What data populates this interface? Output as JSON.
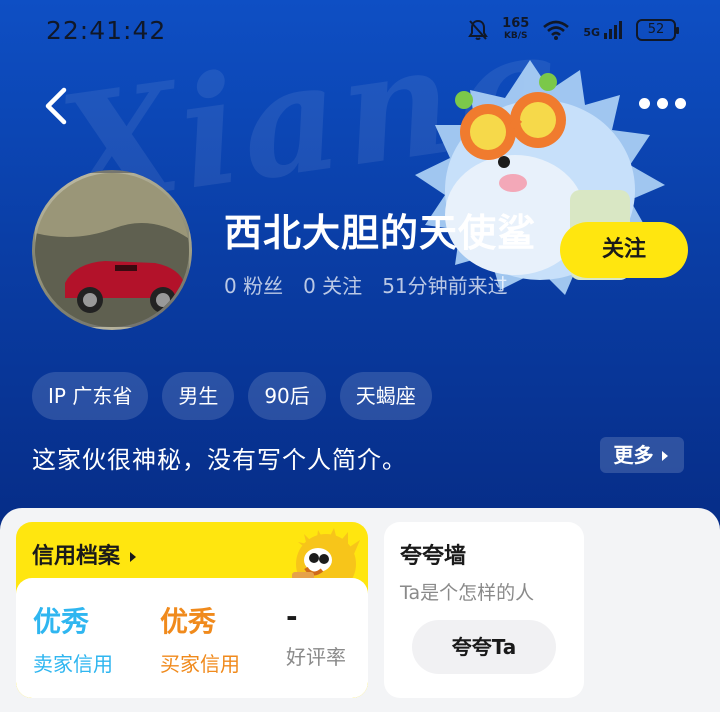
{
  "status_bar": {
    "time": "22:41:42",
    "net_speed": "165",
    "net_unit": "KB/S",
    "network": "5G",
    "battery": "52"
  },
  "profile": {
    "watermark": "Xiang",
    "username": "西北大胆的天使鲨",
    "fans": "0 粉丝",
    "following": "0 关注",
    "last_seen": "51分钟前来过",
    "follow_label": "关注",
    "tags": [
      "IP 广东省",
      "男生",
      "90后",
      "天蝎座"
    ],
    "bio": "这家伙很神秘，没有写个人简介。",
    "more_label": "更多"
  },
  "credit": {
    "title": "信用档案",
    "items": [
      {
        "value": "优秀",
        "label": "卖家信用",
        "color": "#2fb6f0"
      },
      {
        "value": "优秀",
        "label": "买家信用",
        "color": "#f08a1c"
      },
      {
        "value": "-",
        "label": "好评率",
        "color": "#1a1a1a"
      }
    ]
  },
  "praise": {
    "title": "夸夸墙",
    "subtitle": "Ta是个怎样的人",
    "button_label": "夸夸Ta"
  },
  "colors": {
    "accent_yellow": "#ffe60f",
    "hero_blue": "#0a3ea6"
  },
  "icons": [
    "back-arrow-icon",
    "more-dots-icon",
    "bell-off-icon",
    "wifi-icon",
    "signal-icon",
    "battery-icon",
    "triangle-right-icon"
  ]
}
